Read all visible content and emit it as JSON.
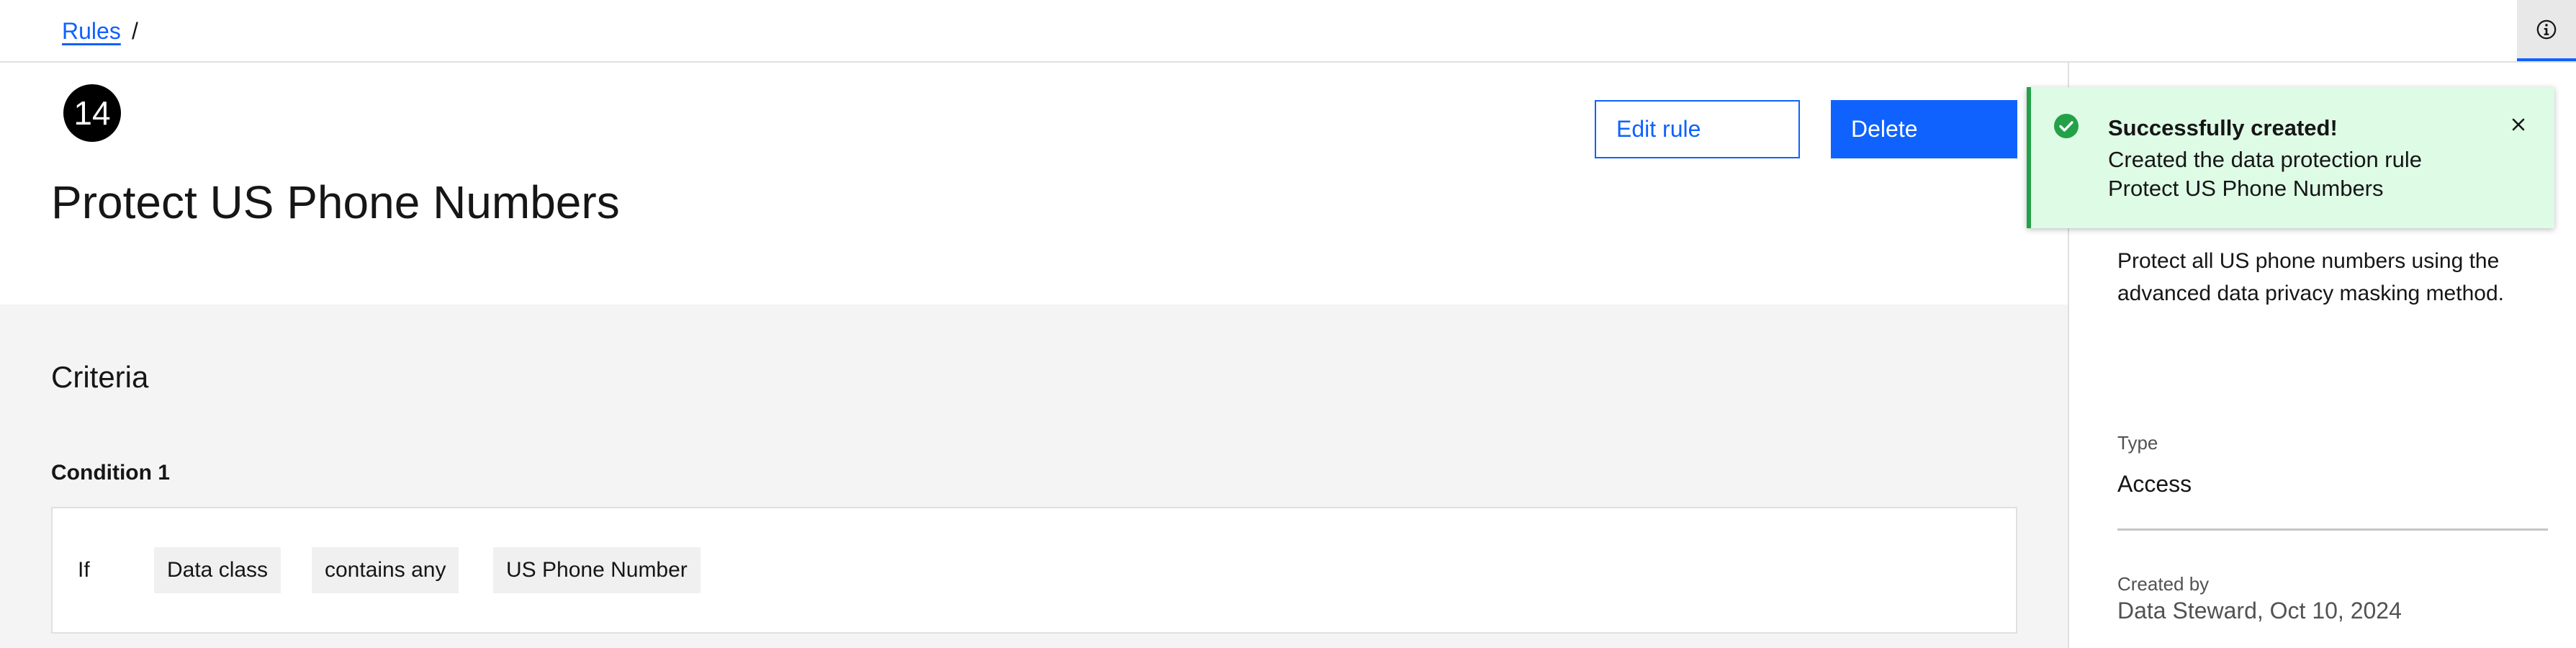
{
  "breadcrumb": {
    "link": "Rules",
    "separator": "/"
  },
  "topbar": {
    "info_icon": "info-icon"
  },
  "rule": {
    "number": "14",
    "title": "Protect US Phone Numbers",
    "actions": {
      "edit_label": "Edit rule",
      "delete_label": "Delete"
    }
  },
  "criteria": {
    "title": "Criteria",
    "conditions": [
      {
        "label": "Condition 1",
        "if_label": "If",
        "tags": [
          "Data class",
          "contains any",
          "US Phone Number"
        ]
      }
    ]
  },
  "side_panel": {
    "description": "Protect all US phone numbers using the advanced data privacy masking method.",
    "type_label": "Type",
    "type_value": "Access",
    "created_label": "Created by",
    "created_value": "Data Steward, Oct 10, 2024"
  },
  "toast": {
    "title": "Successfully created!",
    "subtitle_line1": "Created the data protection rule",
    "subtitle_line2": "Protect US Phone Numbers",
    "icon": "checkmark-filled-icon",
    "close_icon": "close-icon"
  },
  "colors": {
    "primary": "#0f62fe",
    "success": "#24a148",
    "toast_bg": "#defbe6",
    "panel_bg": "#f4f4f4"
  }
}
